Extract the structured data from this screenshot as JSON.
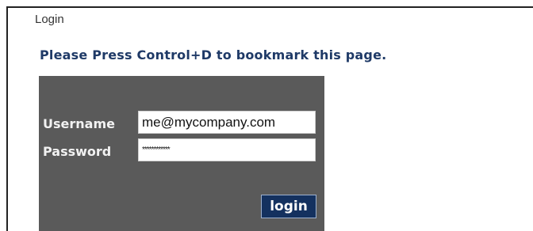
{
  "page": {
    "heading": "Login",
    "bookmark_message": "Please Press Control+D to bookmark this page."
  },
  "login_form": {
    "username_label": "Username",
    "username_value": "me@mycompany.com",
    "password_label": "Password",
    "password_value": "************",
    "login_button_label": "login"
  },
  "colors": {
    "panel_background": "#5a5a5a",
    "button_background": "#14315f",
    "message_text": "#1f3a67"
  }
}
